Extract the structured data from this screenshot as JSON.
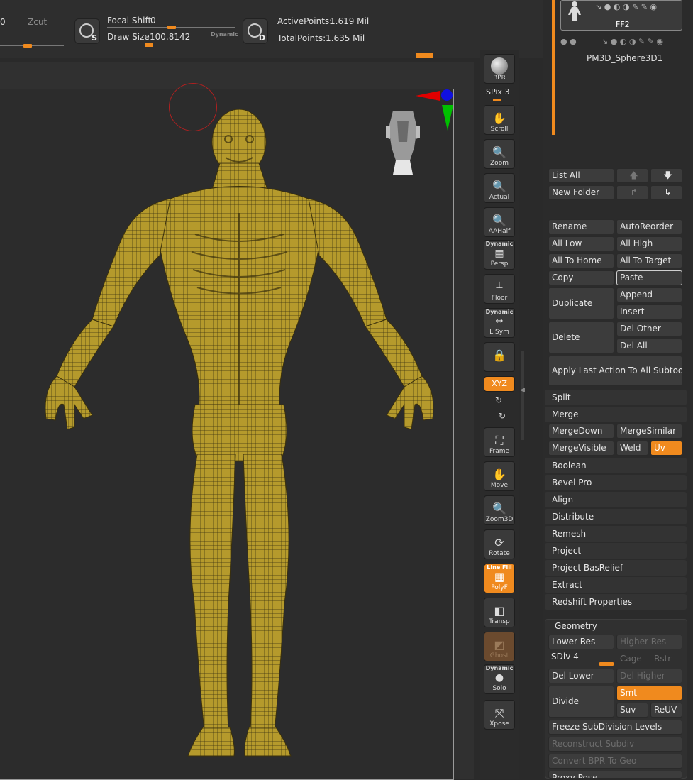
{
  "topbar": {
    "prev_value": "0",
    "zcut_label": "Zcut",
    "focal_shift_label": "Focal Shift",
    "focal_shift_value": "0",
    "draw_size_label": "Draw Size",
    "draw_size_value": "100.8142",
    "dynamic_label": "Dynamic",
    "brush_s_letter": "S",
    "brush_d_letter": "D",
    "active_points_label": "ActivePoints:",
    "active_points_value": "1.619 Mil",
    "total_points_label": "TotalPoints:",
    "total_points_value": "1.635 Mil"
  },
  "shelf": {
    "bpr": "BPR",
    "spix_label": "SPix",
    "spix_value": "3",
    "scroll": "Scroll",
    "zoom": "Zoom",
    "actual": "Actual",
    "aahalf": "AAHalf",
    "persp_top": "Dynamic",
    "persp": "Persp",
    "floor": "Floor",
    "lsym_top": "Dynamic",
    "lsym": "L.Sym",
    "xyz": "XYZ",
    "frame": "Frame",
    "move": "Move",
    "zoom3d": "Zoom3D",
    "rotate": "Rotate",
    "polyf_top": "Line Fill",
    "polyf": "PolyF",
    "transp": "Transp",
    "ghost": "Ghost",
    "solo_top": "Dynamic",
    "solo": "Solo",
    "xpose": "Xpose"
  },
  "subtool": {
    "thumb_name": "FF2",
    "item_name": "PM3D_Sphere3D1",
    "list_all": "List All",
    "new_folder": "New Folder",
    "rename": "Rename",
    "autoreorder": "AutoReorder",
    "all_low": "All Low",
    "all_high": "All High",
    "all_to_home": "All To Home",
    "all_to_target": "All To Target",
    "copy": "Copy",
    "paste": "Paste",
    "duplicate": "Duplicate",
    "append": "Append",
    "insert": "Insert",
    "delete": "Delete",
    "del_other": "Del Other",
    "del_all": "Del All",
    "apply_last": "Apply Last Action To All Subtools",
    "split": "Split",
    "merge": "Merge",
    "mergedown": "MergeDown",
    "mergesimilar": "MergeSimilar",
    "mergevisible": "MergeVisible",
    "weld": "Weld",
    "uv": "Uv",
    "boolean": "Boolean",
    "bevel_pro": "Bevel Pro",
    "align": "Align",
    "distribute": "Distribute",
    "remesh": "Remesh",
    "project": "Project",
    "project_basrelief": "Project BasRelief",
    "extract": "Extract",
    "redshift": "Redshift Properties"
  },
  "geometry": {
    "title": "Geometry",
    "lower_res": "Lower Res",
    "higher_res": "Higher Res",
    "sdiv_label": "SDiv",
    "sdiv_value": "4",
    "cage": "Cage",
    "rstr": "Rstr",
    "del_lower": "Del Lower",
    "del_higher": "Del Higher",
    "divide": "Divide",
    "smt": "Smt",
    "suv": "Suv",
    "reuv": "ReUV",
    "freeze": "Freeze SubDivision Levels",
    "reconstruct": "Reconstruct Subdiv",
    "convert_bpr": "Convert BPR To Geo",
    "proxy_pose": "Proxy Pose"
  },
  "colors": {
    "accent": "#f08a1e",
    "model": "#b59a2c",
    "background": "#2a2a2a"
  }
}
